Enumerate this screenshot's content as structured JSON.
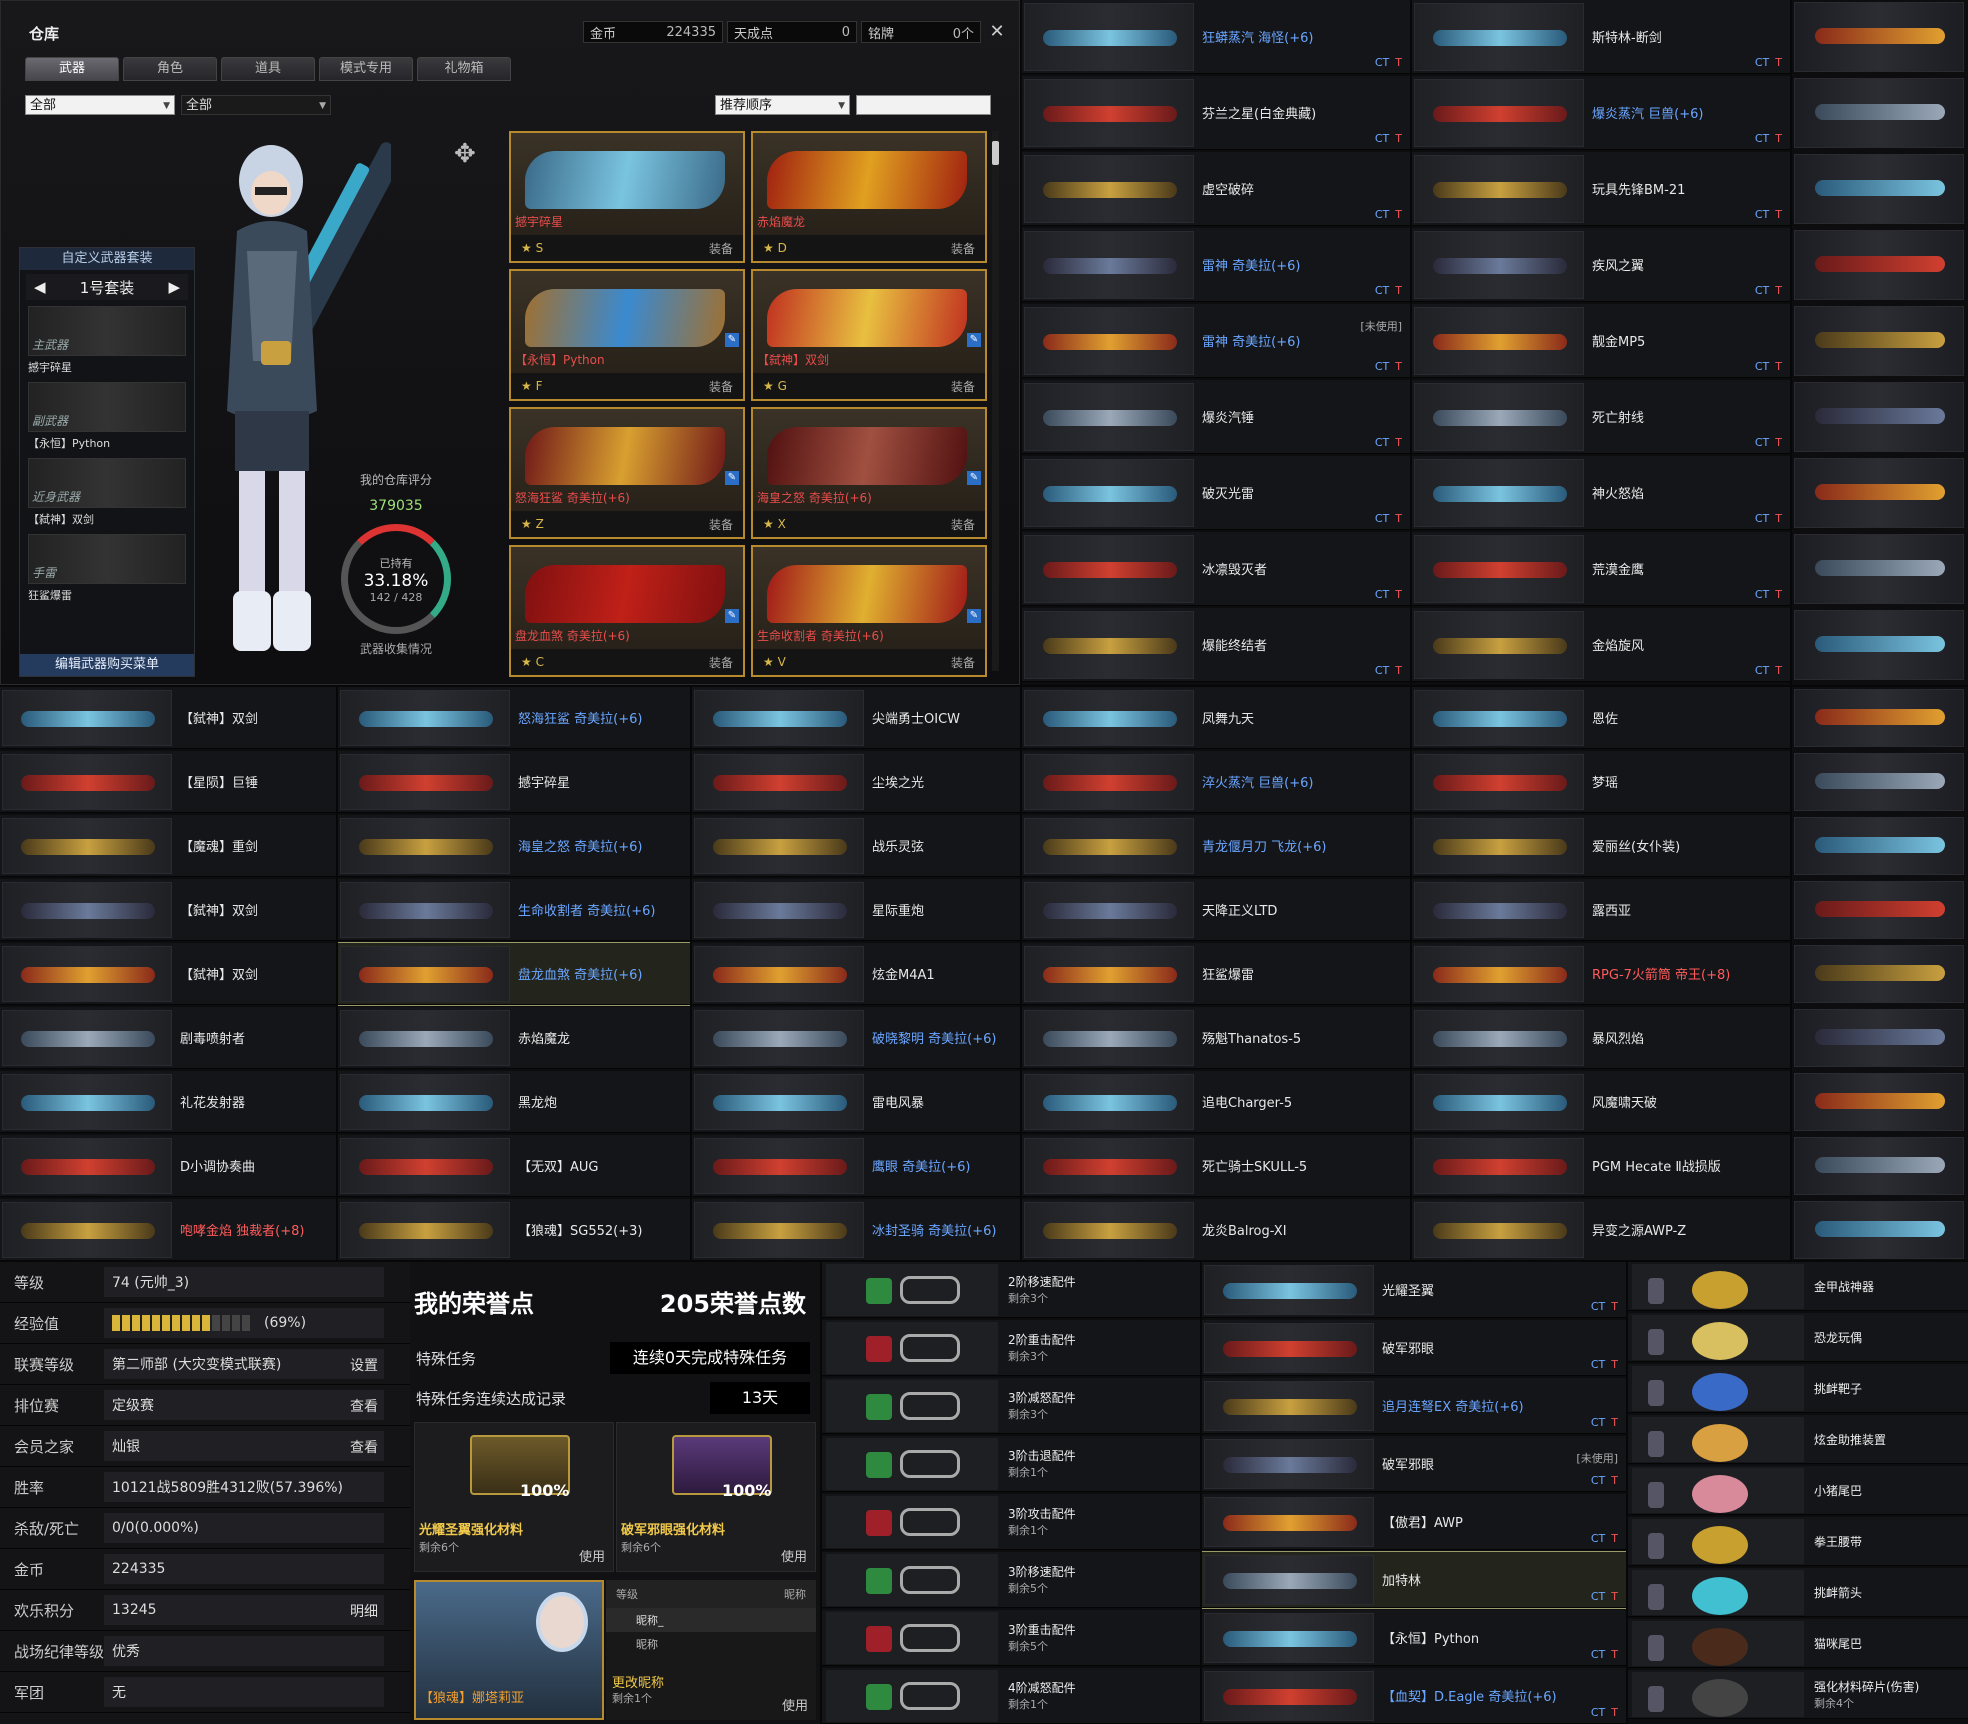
{
  "inventory": {
    "title": "仓库",
    "gold_label": "金币",
    "gold_value": "224335",
    "cash_label": "天成点",
    "cash_value": "0",
    "medal_label": "铭牌",
    "medal_value": "0个",
    "close_glyph": "✕",
    "tabs": [
      "武器",
      "角色",
      "道具",
      "模式专用",
      "礼物箱"
    ],
    "filter1": "全部",
    "filter2": "全部",
    "sort": "推荐顺序",
    "loadout": {
      "title": "自定义武器套装",
      "preset": "1号套装",
      "prev": "◀",
      "next": "▶",
      "slots": [
        {
          "cat": "主武器",
          "name": "撼宇碎星"
        },
        {
          "cat": "副武器",
          "name": "【永恒】Python"
        },
        {
          "cat": "近身武器",
          "name": "【弑神】双剑"
        },
        {
          "cat": "手雷",
          "name": "狂鲨爆雷"
        }
      ],
      "edit": "编辑武器购买菜单"
    },
    "score": {
      "label": "我的仓库评分",
      "value": "379035",
      "owned": "已持有",
      "pct": "33.18%",
      "count": "142 / 428",
      "caption": "武器收集情况"
    },
    "equip_label": "装备",
    "cards": [
      {
        "name": "撼宇碎星",
        "rank": "★ S",
        "c1": "#3a6a88",
        "c2": "#7ac4e0"
      },
      {
        "name": "赤焰魔龙",
        "rank": "★ D",
        "c1": "#a02010",
        "c2": "#e0a020"
      },
      {
        "name": "【永恒】Python",
        "rank": "★ F",
        "c1": "#a07030",
        "c2": "#3a8ad0"
      },
      {
        "name": "【弑神】双剑",
        "rank": "★ G",
        "c1": "#c03020",
        "c2": "#e8c040"
      },
      {
        "name": "怒海狂鲨 奇美拉(+6)",
        "rank": "★ Z",
        "c1": "#701818",
        "c2": "#d8a030"
      },
      {
        "name": "海皇之怒 奇美拉(+6)",
        "rank": "★ X",
        "c1": "#501010",
        "c2": "#a05040"
      },
      {
        "name": "盘龙血煞 奇美拉(+6)",
        "rank": "★ C",
        "c1": "#801010",
        "c2": "#c02018"
      },
      {
        "name": "生命收割者 奇美拉(+6)",
        "rank": "★ V",
        "c1": "#a01818",
        "c2": "#e0b030"
      }
    ]
  },
  "ct_label": "CT",
  "t_label": "T",
  "unused_label": "[未使用]",
  "listA": [
    {
      "n": "狂蟒蒸汽 海怪(+6)",
      "c": "blue"
    },
    {
      "n": "芬兰之星(白金典藏)",
      "c": ""
    },
    {
      "n": "虚空破碎",
      "c": ""
    },
    {
      "n": "雷神 奇美拉(+6)",
      "c": "blue"
    },
    {
      "n": "雷神 奇美拉(+6)",
      "c": "blue",
      "unused": true
    },
    {
      "n": "爆炎汽锤",
      "c": ""
    },
    {
      "n": "破灭光雷",
      "c": ""
    },
    {
      "n": "冰凛毁灭者",
      "c": ""
    },
    {
      "n": "爆能终结者",
      "c": ""
    }
  ],
  "listB": [
    {
      "n": "斯特林-断剑",
      "c": ""
    },
    {
      "n": "爆炎蒸汽 巨兽(+6)",
      "c": "blue"
    },
    {
      "n": "玩具先锋BM-21",
      "c": ""
    },
    {
      "n": "疾风之翼",
      "c": ""
    },
    {
      "n": "靓金MP5",
      "c": ""
    },
    {
      "n": "死亡射线",
      "c": ""
    },
    {
      "n": "神火怒焰",
      "c": ""
    },
    {
      "n": "荒漠金鹰",
      "c": ""
    },
    {
      "n": "金焰旋风",
      "c": ""
    }
  ],
  "listC": [
    {
      "n": "【弑神】双剑",
      "c": ""
    },
    {
      "n": "【星陨】巨锤",
      "c": ""
    },
    {
      "n": "【魔魂】重剑",
      "c": ""
    },
    {
      "n": "【弑神】双剑",
      "c": ""
    },
    {
      "n": "【弑神】双剑",
      "c": ""
    },
    {
      "n": "剧毒喷射者",
      "c": ""
    },
    {
      "n": "礼花发射器",
      "c": ""
    },
    {
      "n": "D小调协奏曲",
      "c": ""
    },
    {
      "n": "咆哮金焰 独裁者(+8)",
      "c": "red"
    }
  ],
  "listD": [
    {
      "n": "怒海狂鲨 奇美拉(+6)",
      "c": "blue"
    },
    {
      "n": "撼宇碎星",
      "c": ""
    },
    {
      "n": "海皇之怒 奇美拉(+6)",
      "c": "blue"
    },
    {
      "n": "生命收割者 奇美拉(+6)",
      "c": "blue"
    },
    {
      "n": "盘龙血煞 奇美拉(+6)",
      "c": "blue"
    },
    {
      "n": "赤焰魔龙",
      "c": ""
    },
    {
      "n": "黑龙炮",
      "c": ""
    },
    {
      "n": "【无双】AUG",
      "c": ""
    },
    {
      "n": "【狼魂】SG552(+3)",
      "c": ""
    }
  ],
  "listE": [
    {
      "n": "尖端勇士OICW",
      "c": ""
    },
    {
      "n": "尘埃之光",
      "c": ""
    },
    {
      "n": "战乐灵弦",
      "c": ""
    },
    {
      "n": "星际重炮",
      "c": ""
    },
    {
      "n": "炫金M4A1",
      "c": ""
    },
    {
      "n": "破晓黎明 奇美拉(+6)",
      "c": "blue"
    },
    {
      "n": "雷电风暴",
      "c": ""
    },
    {
      "n": "鹰眼 奇美拉(+6)",
      "c": "blue"
    },
    {
      "n": "冰封圣骑 奇美拉(+6)",
      "c": "blue"
    }
  ],
  "listF": [
    {
      "n": "凤舞九天",
      "c": ""
    },
    {
      "n": "淬火蒸汽 巨兽(+6)",
      "c": "blue"
    },
    {
      "n": "青龙偃月刀 飞龙(+6)",
      "c": "blue"
    },
    {
      "n": "天降正义LTD",
      "c": ""
    },
    {
      "n": "狂鲨爆雷",
      "c": ""
    },
    {
      "n": "殇魁Thanatos-5",
      "c": ""
    },
    {
      "n": "追电Charger-5",
      "c": ""
    },
    {
      "n": "死亡骑士SKULL-5",
      "c": ""
    },
    {
      "n": "龙炎Balrog-XI",
      "c": ""
    }
  ],
  "listG": [
    {
      "n": "恩佐",
      "c": ""
    },
    {
      "n": "梦瑶",
      "c": ""
    },
    {
      "n": "爱丽丝(女仆装)",
      "c": ""
    },
    {
      "n": "露西亚",
      "c": ""
    },
    {
      "n": "RPG-7火箭筒 帝王(+8)",
      "c": "red"
    },
    {
      "n": "暴风烈焰",
      "c": ""
    },
    {
      "n": "风魔啸天破",
      "c": ""
    },
    {
      "n": "PGM Hecate Ⅱ战损版",
      "c": ""
    },
    {
      "n": "异变之源AWP-Z",
      "c": ""
    }
  ],
  "profile": [
    {
      "k": "等级",
      "v": "74 (元帅_3)"
    },
    {
      "k": "经验值",
      "v": "(69%)"
    },
    {
      "k": "联赛等级",
      "v": "第二师部 (大灾变模式联赛)",
      "btn": "设置"
    },
    {
      "k": "排位赛",
      "v": "定级赛",
      "btn": "查看"
    },
    {
      "k": "会员之家",
      "v": "灿银",
      "btn": "查看"
    },
    {
      "k": "胜率",
      "v": "10121战5809胜4312败(57.396%)"
    },
    {
      "k": "杀敌/死亡",
      "v": "0/0(0.000%)"
    },
    {
      "k": "金币",
      "v": "224335"
    },
    {
      "k": "欢乐积分",
      "v": "13245",
      "btn": "明细"
    },
    {
      "k": "战场纪律等级",
      "v": "优秀"
    },
    {
      "k": "军团",
      "v": "无"
    }
  ],
  "xp_fraction": 0.69,
  "honor": {
    "title": "我的荣誉点",
    "points": "205荣誉点数",
    "mission_label": "特殊任务",
    "mission_value": "连续0天完成特殊任务",
    "record_label": "特殊任务连续达成记录",
    "record_value": "13天",
    "boxes": [
      {
        "name": "光耀圣翼强化材料",
        "pct": "100%",
        "sub": "剩余6个",
        "use": "使用"
      },
      {
        "name": "破军邪眼强化材料",
        "pct": "100%",
        "sub": "剩余6个",
        "use": "使用"
      }
    ],
    "char_name": "【狼魂】娜塔莉亚",
    "nick_level": "等级",
    "nick_col": "昵称",
    "nick_r1": "昵称_",
    "nick_r2": "昵称",
    "rename": "更改昵称",
    "rename_sub": "剩余1个",
    "rename_use": "使用"
  },
  "parts": [
    {
      "n": "2阶移速配件",
      "r": "剩余3个",
      "col": "#2e8a3e"
    },
    {
      "n": "2阶重击配件",
      "r": "剩余3个",
      "col": "#a0202a"
    },
    {
      "n": "3阶减怒配件",
      "r": "剩余3个",
      "col": "#2e8a3e"
    },
    {
      "n": "3阶击退配件",
      "r": "剩余1个",
      "col": "#2e8a3e"
    },
    {
      "n": "3阶攻击配件",
      "r": "剩余1个",
      "col": "#a0202a"
    },
    {
      "n": "3阶移速配件",
      "r": "剩余5个",
      "col": "#2e8a3e"
    },
    {
      "n": "3阶重击配件",
      "r": "剩余5个",
      "col": "#a0202a"
    },
    {
      "n": "4阶减怒配件",
      "r": "剩余1个",
      "col": "#2e8a3e"
    }
  ],
  "listH": [
    {
      "n": "光耀圣翼",
      "c": ""
    },
    {
      "n": "破军邪眼",
      "c": ""
    },
    {
      "n": "追月连弩EX 奇美拉(+6)",
      "c": "blue"
    },
    {
      "n": "破军邪眼",
      "c": "",
      "unused": true
    },
    {
      "n": "【傲君】AWP",
      "c": ""
    },
    {
      "n": "加特林",
      "c": ""
    },
    {
      "n": "【永恒】Python",
      "c": ""
    },
    {
      "n": "【血契】D.Eagle 奇美拉(+6)",
      "c": "blue"
    }
  ],
  "extras": [
    {
      "n": "金甲战神器",
      "r": "",
      "col": "#c8a030"
    },
    {
      "n": "恐龙玩偶",
      "r": "",
      "col": "#d8c060"
    },
    {
      "n": "挑衅靶子",
      "r": "",
      "col": "#3a6ac8"
    },
    {
      "n": "炫金助推装置",
      "r": "",
      "col": "#d8a040"
    },
    {
      "n": "小猪尾巴",
      "r": "",
      "col": "#d88a9a"
    },
    {
      "n": "拳王腰带",
      "r": "",
      "col": "#c8a030"
    },
    {
      "n": "挑衅箭头",
      "r": "",
      "col": "#40c0d0"
    },
    {
      "n": "猫咪尾巴",
      "r": "",
      "col": "#4a2a1a"
    },
    {
      "n": "强化材料碎片(伤害)",
      "r": "剩余4个",
      "col": "#444"
    }
  ]
}
